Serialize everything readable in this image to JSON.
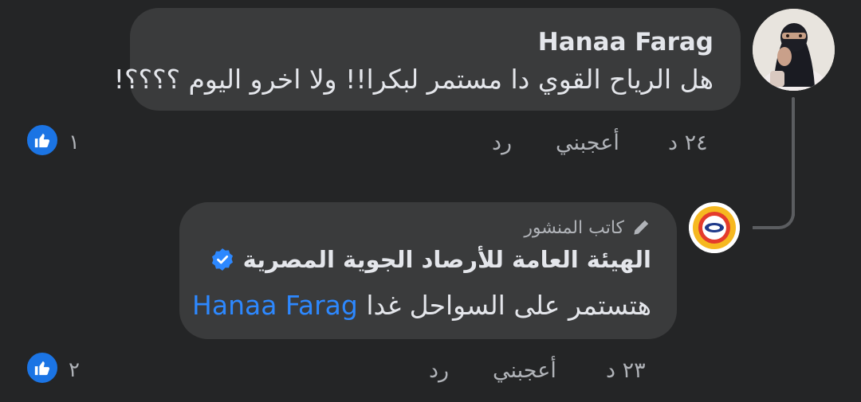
{
  "comment": {
    "author": "Hanaa Farag",
    "text": "هل الرياح القوي دا مستمر لبكرا!! ولا اخرو اليوم ؟؟؟؟!",
    "time": "٢٤ د",
    "like_label": "أعجبني",
    "reply_label": "رد",
    "reaction_count": "١"
  },
  "reply": {
    "role_label": "كاتب المنشور",
    "author": "الهيئة العامة للأرصاد الجوية المصرية",
    "text": "هتستمر على السواحل غدا",
    "mention": "Hanaa Farag",
    "time": "٢٣ د",
    "like_label": "أعجبني",
    "reply_label": "رد",
    "reaction_count": "٢"
  },
  "colors": {
    "background": "#242526",
    "bubble": "#3a3b3c",
    "accent": "#1b74e4",
    "mention": "#2d88ff",
    "secondary_text": "#b0b3b8"
  },
  "icons": {
    "like": "thumbs-up-icon",
    "author_badge": "pen-icon",
    "verified": "verified-badge-icon"
  }
}
